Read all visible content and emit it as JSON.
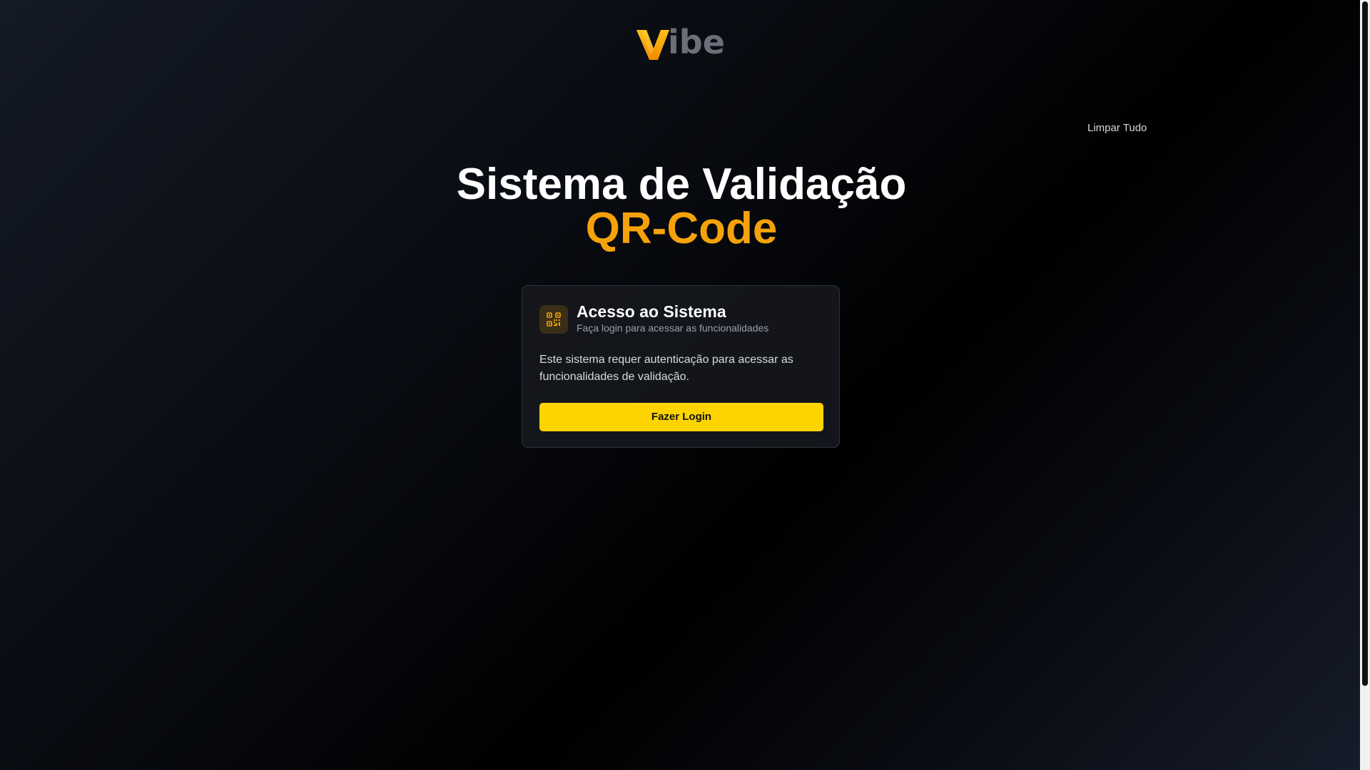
{
  "header": {
    "logo_text": "ibe",
    "logo_mark": "V",
    "logo_icon": "vibe-logo",
    "clear_all_label": "Limpar Tudo"
  },
  "hero": {
    "title_line1": "Sistema de Validação",
    "title_line2": "QR-Code",
    "accent_color": "#f5a20a"
  },
  "login_card": {
    "icon": "qr-code-icon",
    "title": "Acesso ao Sistema",
    "subtitle": "Faça login para acessar as funcionalidades",
    "body": "Este sistema requer autenticação para acessar as funcionalidades de validação.",
    "button_label": "Fazer Login",
    "button_color": "#fdd400"
  },
  "colors": {
    "background_dark": "#000000",
    "card_border": "#2e333d"
  }
}
